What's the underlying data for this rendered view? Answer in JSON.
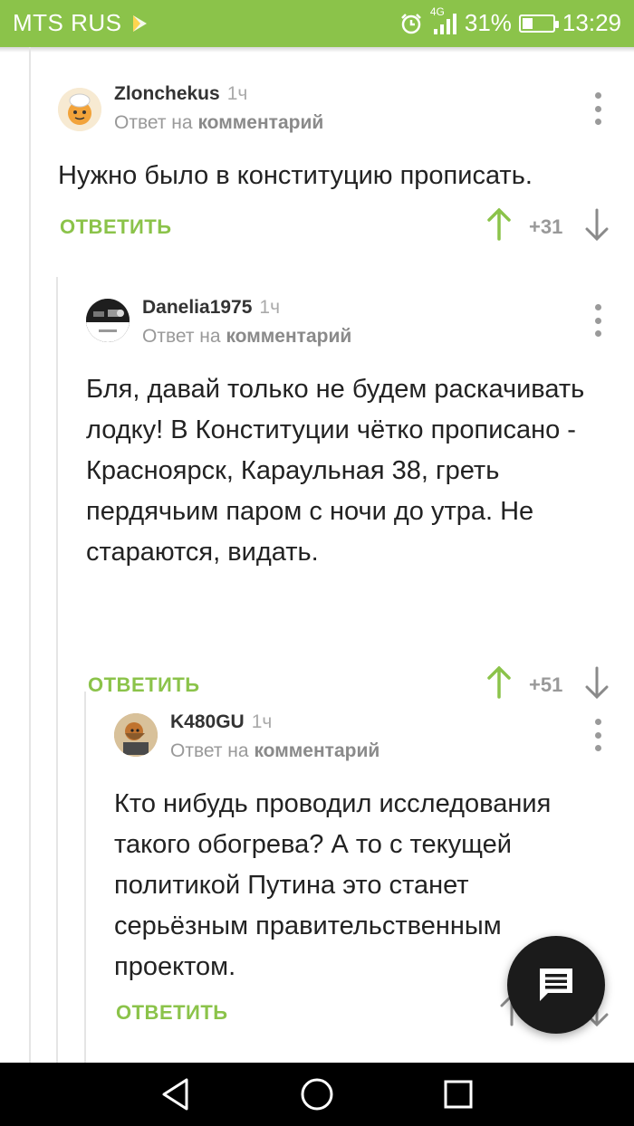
{
  "status_bar": {
    "carrier": "MTS RUS",
    "network": "4G",
    "battery_percent": "31%",
    "battery_level": 0.31,
    "time": "13:29"
  },
  "comments": [
    {
      "author": "Zlonchekus",
      "time": "1ч",
      "reply_prefix": "Ответ на",
      "reply_target": "комментарий",
      "text": "Нужно было в конституцию прописать.",
      "reply_label": "ОТВЕТИТЬ",
      "score": "+31"
    },
    {
      "author": "Danelia1975",
      "time": "1ч",
      "reply_prefix": "Ответ на",
      "reply_target": "комментарий",
      "text": "Бля, давай только не будем раскачивать лодку! В Конституции чётко прописано - Красноярск, Караульная 38, греть пердячьим паром с ночи до утра. Не стараются, видать.",
      "reply_label": "ОТВЕТИТЬ",
      "score": "+51"
    },
    {
      "author": "K480GU",
      "time": "1ч",
      "reply_prefix": "Ответ на",
      "reply_target": "комментарий",
      "text": "Кто нибудь проводил исследования такого обогрева? А то с текущей политикой Путина это станет серьёзным правительственным проектом.",
      "reply_label": "ОТВЕТИТЬ"
    }
  ],
  "colors": {
    "accent": "#8bc34a",
    "fab": "#1b1b1b"
  },
  "icons": {
    "fab": "comment-icon",
    "nav": [
      "back-icon",
      "home-icon",
      "recents-icon"
    ]
  }
}
